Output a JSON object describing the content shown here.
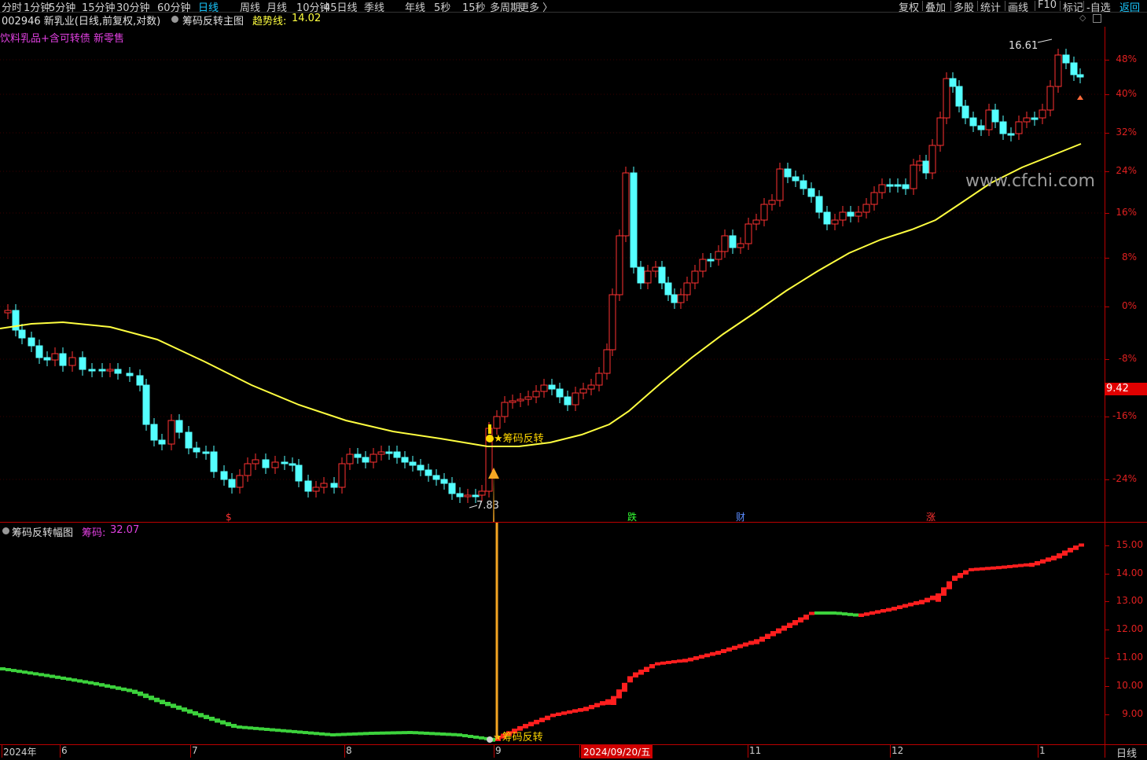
{
  "toolbar": {
    "periods": [
      "分时",
      "1分钟",
      "5分钟",
      "15分钟",
      "30分钟",
      "60分钟",
      "日线",
      "周线",
      "月线",
      "10分钟",
      "45日线",
      "季线",
      "年线",
      "5秒",
      "15秒",
      "多周期",
      "更多 〉"
    ],
    "active_period": "日线",
    "right_items": [
      "复权",
      "叠加",
      "多股",
      "统计",
      "画线",
      "F10",
      "标记",
      "-自选",
      "返回"
    ]
  },
  "title": {
    "stock_code_name": "002946 新乳业(日线,前复权,对数)",
    "indicator_name": "筹码反转主图",
    "trend_line_label": "趋势线:",
    "trend_line_value": "14.02",
    "sector_tags": "饮料乳品+含可转债 新零售"
  },
  "main_chart": {
    "high_label": "16.61",
    "low_label": "7.83",
    "signal_label": "★筹码反转",
    "current_price": "9.42",
    "watermark": "www.cfchi.com",
    "event_markers": [
      "$",
      "跌",
      "财",
      "涨"
    ],
    "axis_labels": [
      "48%",
      "40%",
      "32%",
      "24%",
      "16%",
      "8%",
      "0%",
      "-8%",
      "-16%",
      "-24%"
    ]
  },
  "sub_chart": {
    "title": "筹码反转幅图",
    "value_label": "筹码:",
    "value": "32.07",
    "signal_label": "★筹码反转",
    "axis_labels": [
      "15.00",
      "14.00",
      "13.00",
      "12.00",
      "11.00",
      "10.00",
      "9.00"
    ]
  },
  "date_axis": {
    "labels": [
      "2024年",
      "6",
      "7",
      "8",
      "9",
      "2024/09/20/五",
      "11",
      "12",
      "1"
    ]
  },
  "period_label": "日线",
  "colors": {
    "up": "#ff3232",
    "down": "#54ffff",
    "trend": "#ffff40",
    "axis": "#e02020",
    "signal": "#ffd700",
    "sub_green": "#3cd23c",
    "sub_red": "#ff1e1e"
  }
}
